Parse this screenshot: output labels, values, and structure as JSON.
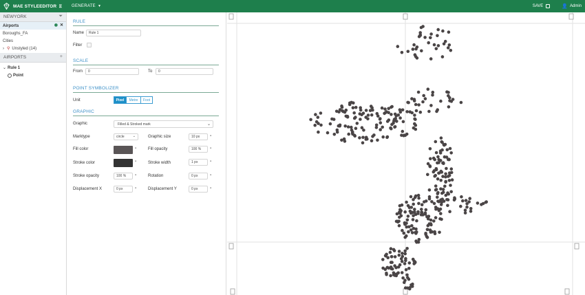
{
  "header": {
    "app_title": "MAE STYLEEDITOR",
    "generate_label": "GENERATE",
    "save_label": "SAVE",
    "user_label": "Admin"
  },
  "layers_panel": {
    "title": "NEWYORK",
    "items": [
      {
        "label": "Airports"
      },
      {
        "label": "Boroughs_FA"
      },
      {
        "label": "Cities"
      },
      {
        "label": "Unstyled (14)"
      }
    ]
  },
  "rules_panel": {
    "title": "AIRPORTS",
    "rule": "Rule 1",
    "symbolizer": "Point"
  },
  "editor": {
    "rule_heading": "RULE",
    "name_label": "Name",
    "name_value": "Rule 1",
    "filter_label": "Filter",
    "scale_heading": "SCALE",
    "from_label": "From",
    "from_value": "0",
    "to_label": "To",
    "to_value": "0",
    "symbolizer_heading": "POINT SYMBOLIZER",
    "unit_label": "Unit",
    "units": [
      "Pixel",
      "Metre",
      "Foot"
    ],
    "selected_unit": "Pixel",
    "graphic_heading": "GRAPHIC",
    "graphic_label": "Graphic",
    "graphic_value": "Filled & Stroked mark",
    "marktype_label": "Marktype",
    "marktype_value": "circle",
    "graphic_size_label": "Graphic size",
    "graphic_size_value": "10 px",
    "fill_color_label": "Fill color",
    "fill_color": "#5a5556",
    "fill_opacity_label": "Fill opacity",
    "fill_opacity_value": "100 %",
    "stroke_color_label": "Stroke color",
    "stroke_color": "#333333",
    "stroke_width_label": "Stroke width",
    "stroke_width_value": "1 px",
    "stroke_opacity_label": "Stroke opacity",
    "stroke_opacity_value": "100 %",
    "rotation_label": "Rotation",
    "rotation_value": "0 px",
    "displacement_x_label": "Displacement X",
    "displacement_x_value": "0 px",
    "displacement_y_label": "Displacement Y",
    "displacement_y_value": "0 px"
  },
  "colors": {
    "header_green": "#1e7f4c",
    "accent_blue": "#3a8fc7",
    "point_color": "#4a4546"
  }
}
